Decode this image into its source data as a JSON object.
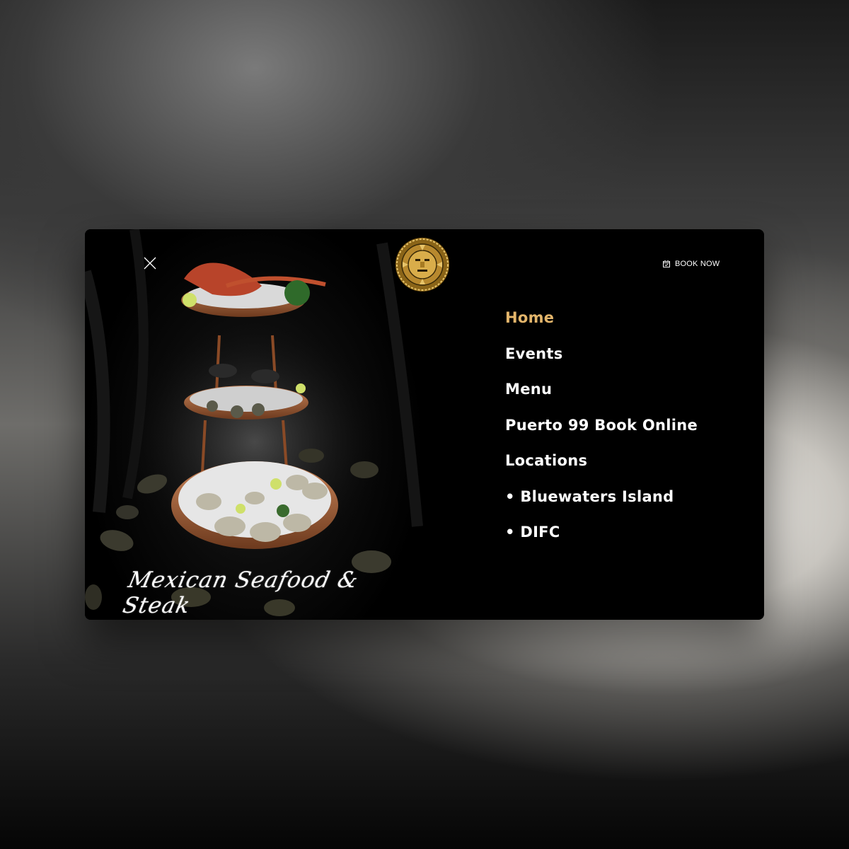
{
  "header": {
    "book_now_label": "BOOK NOW",
    "close_icon": "close-icon",
    "calendar_icon": "calendar-check-icon",
    "logo": "aztec-sun-mask-logo"
  },
  "nav": {
    "items": [
      {
        "label": "Home",
        "active": true
      },
      {
        "label": "Events",
        "active": false
      },
      {
        "label": "Menu",
        "active": false
      },
      {
        "label": "Puerto 99 Book Online",
        "active": false
      },
      {
        "label": "Locations",
        "active": false
      },
      {
        "label": "• Bluewaters Island",
        "active": false
      },
      {
        "label": "• DIFC",
        "active": false
      }
    ]
  },
  "hero": {
    "tagline": "Mexican Seafood & Steak"
  },
  "colors": {
    "accent": "#e3b56b",
    "panel": "#000000",
    "text": "#ffffff",
    "gold": "#c99a3a"
  }
}
